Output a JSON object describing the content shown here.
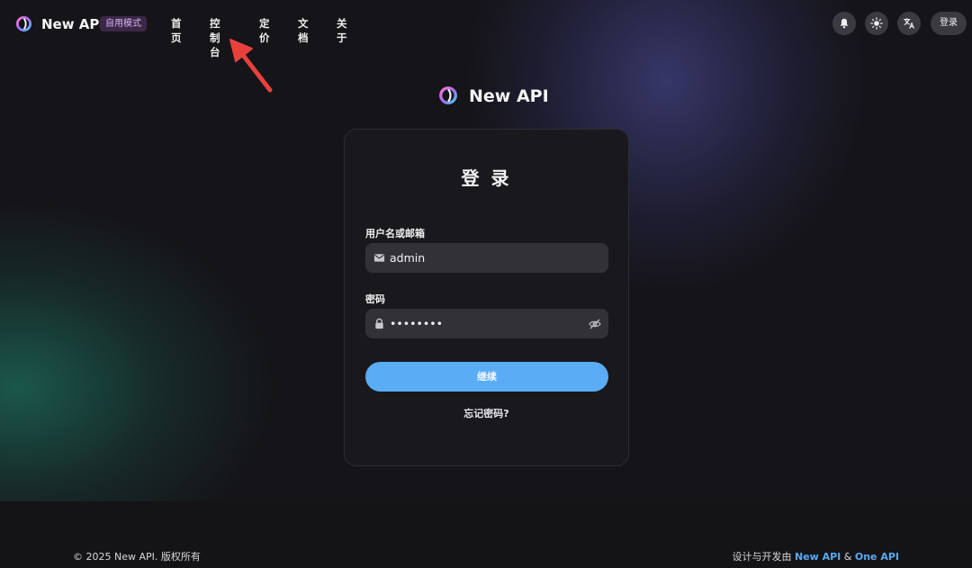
{
  "header": {
    "brand": "New API",
    "mode_badge": "自用模式",
    "nav": [
      "首页",
      "控制台",
      "定价",
      "文档",
      "关于"
    ],
    "login_label": "登录",
    "icons": [
      "bell-icon",
      "sun-icon",
      "translate-icon"
    ]
  },
  "center": {
    "brand": "New API"
  },
  "login_card": {
    "title": "登 录",
    "username_label": "用户名或邮箱",
    "username_value": "admin",
    "password_label": "密码",
    "password_value": "••••••••",
    "submit_label": "继续",
    "forgot_label": "忘记密码?"
  },
  "footer": {
    "copyright": "© 2025 New API. 版权所有",
    "credits_prefix": "设计与开发由 ",
    "credits_link1": "New API",
    "credits_amp": " & ",
    "credits_link2": "One API"
  },
  "colors": {
    "accent": "#5aacf5",
    "badge_bg": "#3b2748",
    "arrow": "#e8413c"
  }
}
